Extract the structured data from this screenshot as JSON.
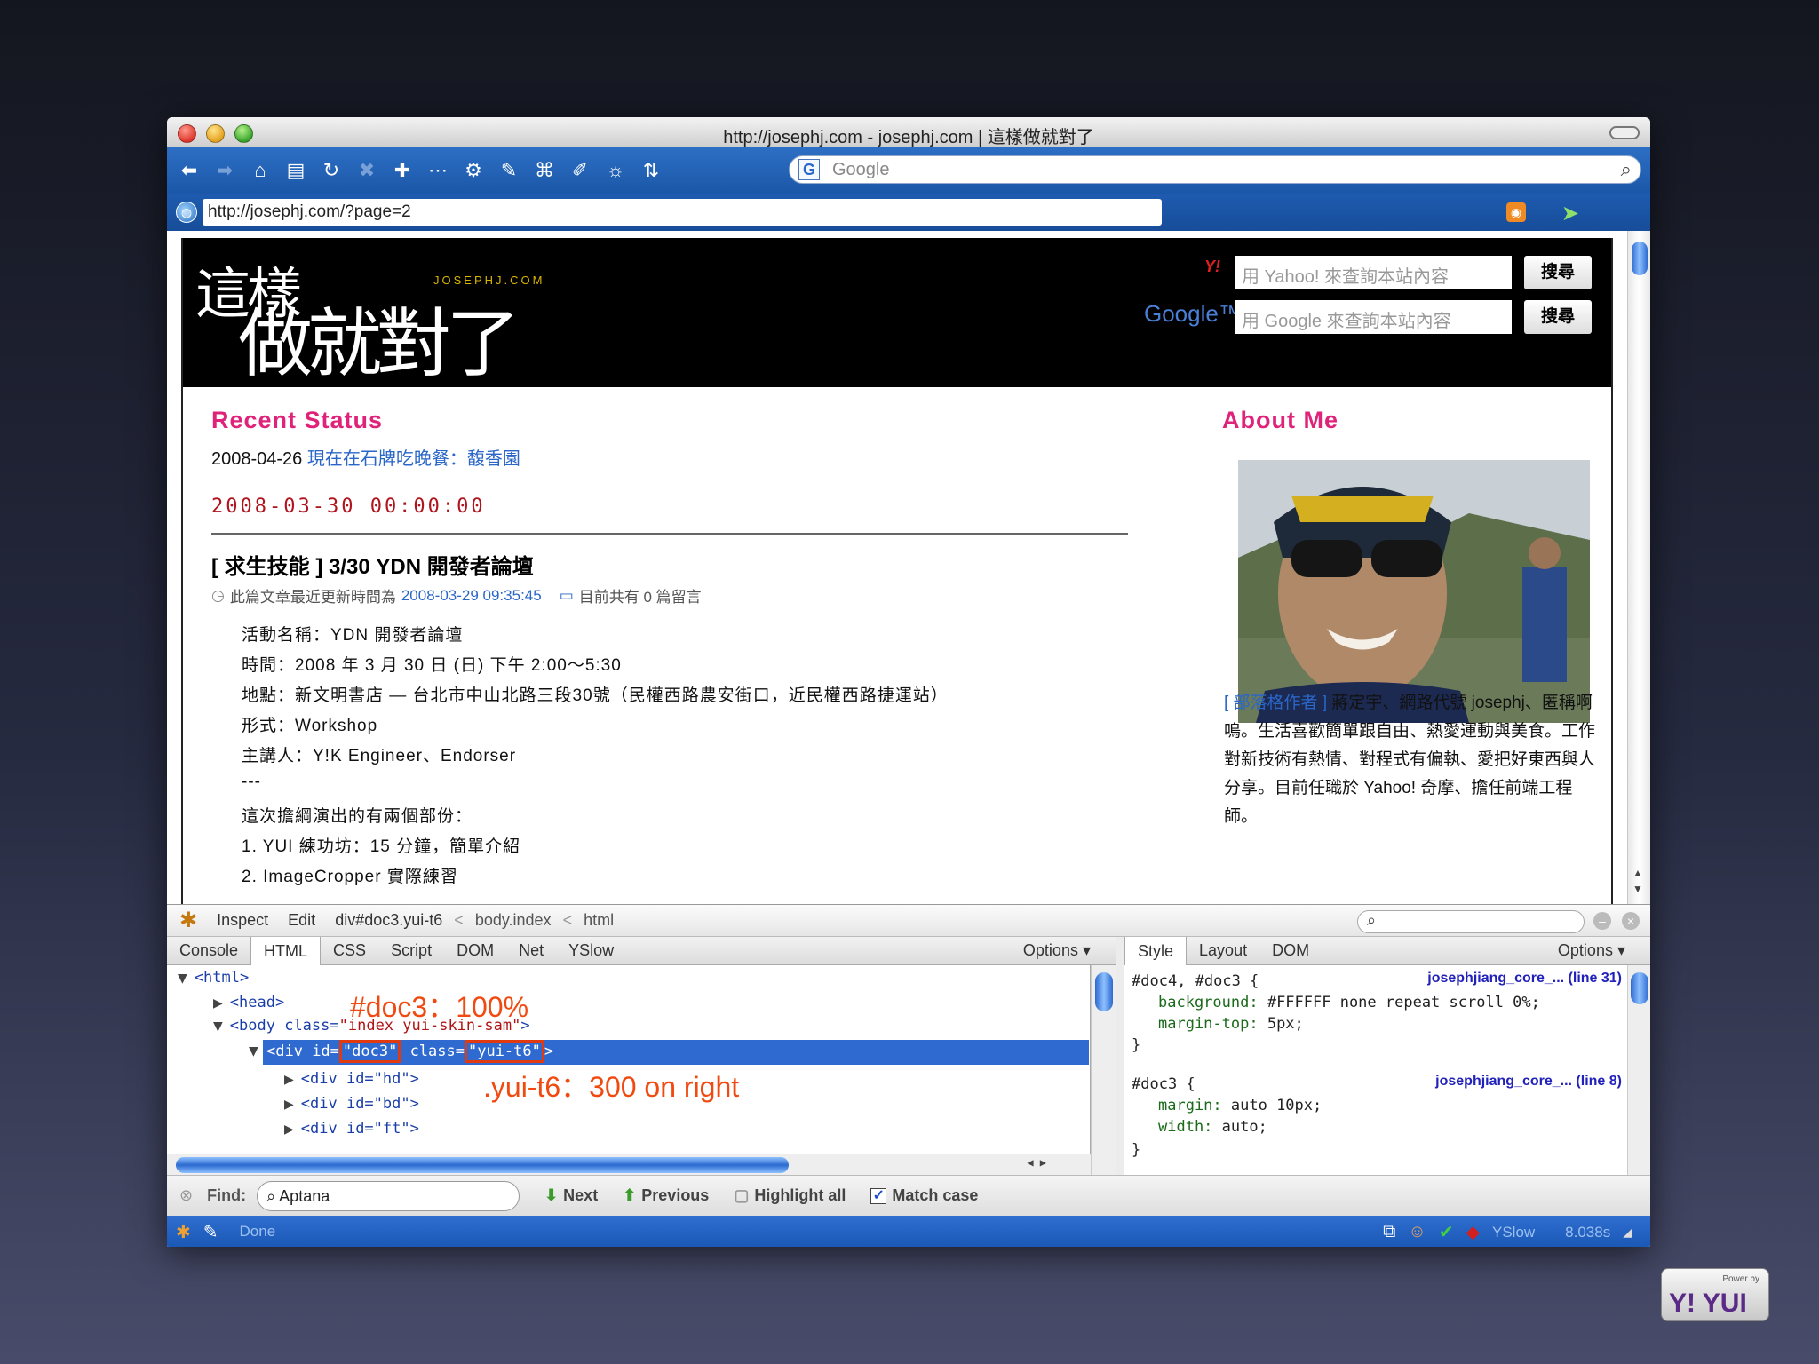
{
  "window": {
    "title": "http://josephj.com - josephj.com | 這樣做就對了"
  },
  "toolbar": {
    "search_placeholder": "Google",
    "search_engine_icon": "G"
  },
  "address": {
    "url": "http://josephj.com/?page=2"
  },
  "site": {
    "logo_line1": "這樣",
    "logo_line2": "做就對了",
    "logo_small": "JOSEPHJ.COM",
    "yahoo_label": "Y!",
    "google_label": "Google™",
    "yahoo_placeholder": "用 Yahoo! 來查詢本站內容",
    "google_placeholder": "用 Google 來查詢本站內容",
    "search_button": "搜尋",
    "recent_heading": "Recent Status",
    "recent_date": "2008-04-26",
    "recent_link": "現在在石牌吃晚餐：馥香園",
    "post_datetime": "2008-03-30 00:00:00",
    "post_title": "[ 求生技能 ] 3/30 YDN 開發者論壇",
    "post_meta_prefix": "此篇文章最近更新時間為",
    "post_meta_date": "2008-03-29 09:35:45",
    "post_meta_comments": "目前共有 0 篇留言",
    "post_lines": [
      "活動名稱：YDN 開發者論壇",
      "時間：2008 年 3 月 30 日 (日) 下午 2:00～5:30",
      "地點：新文明書店 — 台北市中山北路三段30號（民權西路農安街口，近民權西路捷運站）",
      "形式：Workshop",
      "主講人：Y!K Engineer、Endorser",
      "---",
      "這次擔綱演出的有兩個部份：",
      "1. YUI 練功坊：15 分鐘，簡單介紹",
      "2. ImageCropper 實際練習"
    ],
    "about_heading": "About Me",
    "bio_tag": "[ 部落格作者 ]",
    "bio_text": "蔣定宇、網路代號 josephj、匿稱啊鳴。生活喜歡簡單跟自由、熱愛運動與美食。工作對新技術有熱情、對程式有偏執、愛把好東西與人分享。目前任職於 Yahoo! 奇摩、擔任前端工程師。"
  },
  "firebug": {
    "inspect": "Inspect",
    "edit": "Edit",
    "crumb_current": "div#doc3.yui-t6",
    "crumb_sep1": "<",
    "crumb_body": "body.index",
    "crumb_sep2": "<",
    "crumb_html": "html",
    "tabs": [
      "Console",
      "HTML",
      "CSS",
      "Script",
      "DOM",
      "Net",
      "YSlow"
    ],
    "options": "Options ▾",
    "side_tabs": [
      "Style",
      "Layout",
      "DOM"
    ],
    "tree": {
      "html": "<html>",
      "head": "<head>",
      "body_open": "<body ",
      "body_attr": "class=",
      "body_val": "\"index yui-skin-sam\"",
      "body_close": ">",
      "div_open": "<div ",
      "id_attr": "id=",
      "id_val": "\"doc3\"",
      "class_attr": " class=",
      "class_val": "\"yui-t6\"",
      "div_close": ">",
      "hd": "<div id=\"hd\">",
      "bd": "<div id=\"bd\">",
      "ft": "<div id=\"ft\">"
    },
    "annotations": {
      "doc3": "#doc3：100%",
      "yuit6": ".yui-t6：300 on right"
    },
    "styles": {
      "rule1_selector": "#doc4, #doc3 {",
      "rule1_source": "josephjiang_core_... (line 31)",
      "rule1_bg": "background:",
      "rule1_bg_val": " #FFFFFF none repeat scroll 0%;",
      "rule1_mt": "margin-top:",
      "rule1_mt_val": " 5px;",
      "close": "}",
      "rule2_selector": "#doc3 {",
      "rule2_source": "josephjiang_core_... (line 8)",
      "rule2_margin": "margin:",
      "rule2_margin_val": " auto 10px;",
      "rule2_width": "width:",
      "rule2_width_val": " auto;"
    },
    "find_label": "Find:",
    "find_value": "Aptana",
    "next": "Next",
    "previous": "Previous",
    "highlight_all": "Highlight all",
    "match_case": "Match case",
    "status_done": "Done",
    "yslow": "YSlow",
    "timing": "8.038s"
  },
  "badge": {
    "power_by": "Power by",
    "yui": "Y! YUI"
  },
  "colors": {
    "accent_pink": "#e0237a",
    "link_blue": "#2a66c8",
    "annotation_orange": "#f04a10",
    "selection_blue": "#2f6ad0"
  }
}
